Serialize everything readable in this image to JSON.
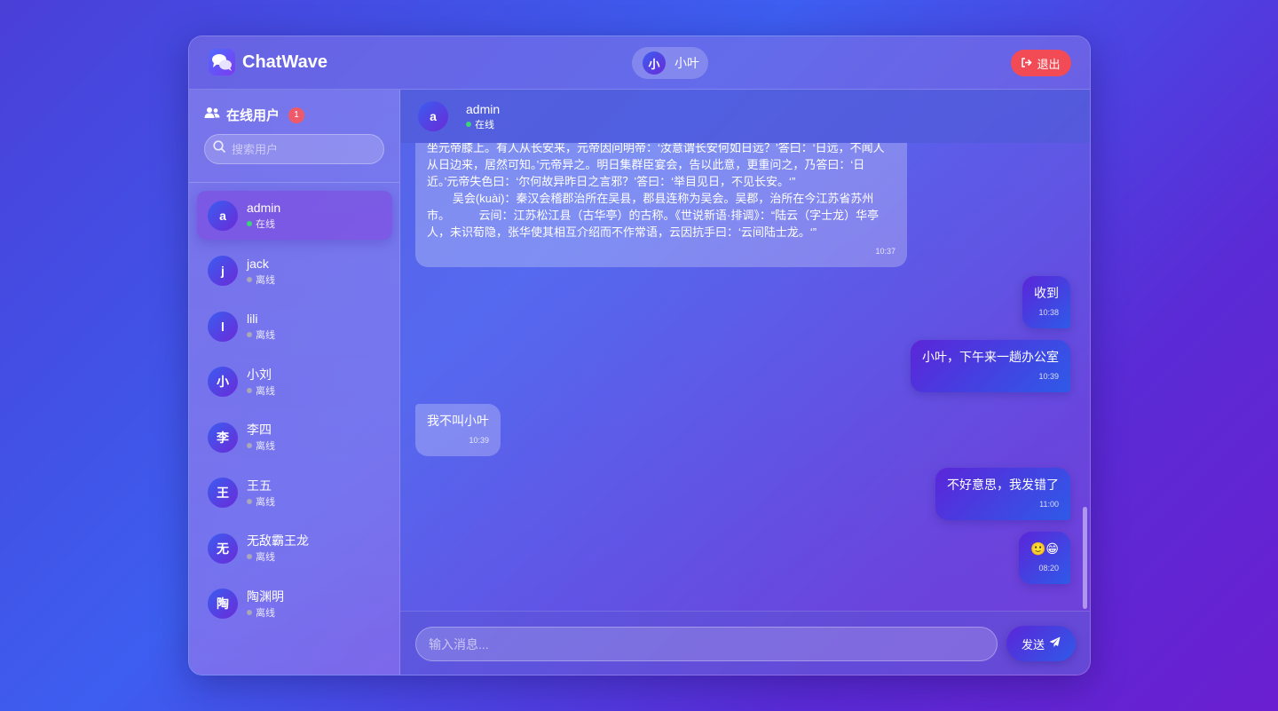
{
  "app": {
    "brand": "ChatWave",
    "logo_icon": "chat-bubbles-icon"
  },
  "current_user": {
    "avatar": "小",
    "name": "小叶"
  },
  "logout": {
    "label": "退出",
    "icon": "sign-out-icon"
  },
  "sidebar": {
    "title": "在线用户",
    "online_count": "1",
    "search_placeholder": "搜索用户",
    "users": [
      {
        "avatar": "a",
        "name": "admin",
        "status": "在线",
        "online": true,
        "active": true
      },
      {
        "avatar": "j",
        "name": "jack",
        "status": "离线",
        "online": false
      },
      {
        "avatar": "l",
        "name": "lili",
        "status": "离线",
        "online": false
      },
      {
        "avatar": "小",
        "name": "小刘",
        "status": "离线",
        "online": false
      },
      {
        "avatar": "李",
        "name": "李四",
        "status": "离线",
        "online": false
      },
      {
        "avatar": "王",
        "name": "王五",
        "status": "离线",
        "online": false
      },
      {
        "avatar": "无",
        "name": "无敌霸王龙",
        "status": "离线",
        "online": false
      },
      {
        "avatar": "陶",
        "name": "陶渊明",
        "status": "离线",
        "online": false
      }
    ]
  },
  "chat": {
    "contact": {
      "avatar": "a",
      "name": "admin",
      "status": "在线"
    },
    "messages": [
      {
        "dir": "in",
        "text": "坐元帝膝上。有人从长安来，元帝因问明帝：‘汝意谓长安何如日远？’答曰：‘日远，不闻人从日边来，居然可知。’元帝异之。明日集群臣宴会，告以此意，更重问之，乃答曰：‘日近。’元帝失色曰：‘尔何故异昨日之言邪？’答曰：‘举目见日，不见长安。‘”\n        吴会(kuài)：秦汉会稽郡治所在吴县，郡县连称为吴会。吴郡，治所在今江苏省苏州市。         云间：江苏松江县（古华亭）的古称。《世说新语·排调》：“陆云（字士龙）华亭人，未识荀隐，张华使其相互介绍而不作常语，云因抗手曰：‘云间陆士龙。‘”",
        "time": "10:37"
      },
      {
        "dir": "out",
        "text": "收到",
        "time": "10:38"
      },
      {
        "dir": "out",
        "text": "小叶，下午来一趟办公室",
        "time": "10:39"
      },
      {
        "dir": "in",
        "text": "我不叫小叶",
        "time": "10:39"
      },
      {
        "dir": "out",
        "text": "不好意思，我发错了",
        "time": "11:00"
      },
      {
        "dir": "out",
        "text": "🙂😁",
        "time": "08:20"
      }
    ],
    "input_placeholder": "输入消息...",
    "send_label": "发送",
    "send_icon": "paper-plane-icon"
  }
}
